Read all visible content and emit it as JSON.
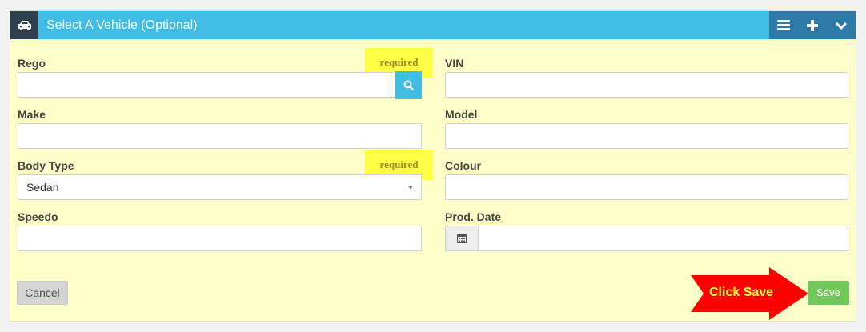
{
  "header": {
    "title": "Select A Vehicle (Optional)",
    "icon": "car-icon",
    "tools": [
      "list-icon",
      "plus-icon",
      "chevron-down-icon"
    ]
  },
  "form": {
    "rego": {
      "label": "Rego",
      "value": "",
      "required": "required"
    },
    "vin": {
      "label": "VIN",
      "value": ""
    },
    "make": {
      "label": "Make",
      "value": ""
    },
    "model": {
      "label": "Model",
      "value": ""
    },
    "body_type": {
      "label": "Body Type",
      "value": "Sedan",
      "required": "required"
    },
    "colour": {
      "label": "Colour",
      "value": ""
    },
    "speedo": {
      "label": "Speedo",
      "value": ""
    },
    "prod_date": {
      "label": "Prod. Date",
      "value": ""
    }
  },
  "footer": {
    "cancel_label": "Cancel",
    "save_label": "Save",
    "annotation": "Click Save"
  },
  "colors": {
    "header_bg": "#41bce5",
    "panel_bg": "#ffffc9",
    "highlight": "#ffff46",
    "save_green": "#72c75b",
    "arrow_red": "#ff0000"
  }
}
